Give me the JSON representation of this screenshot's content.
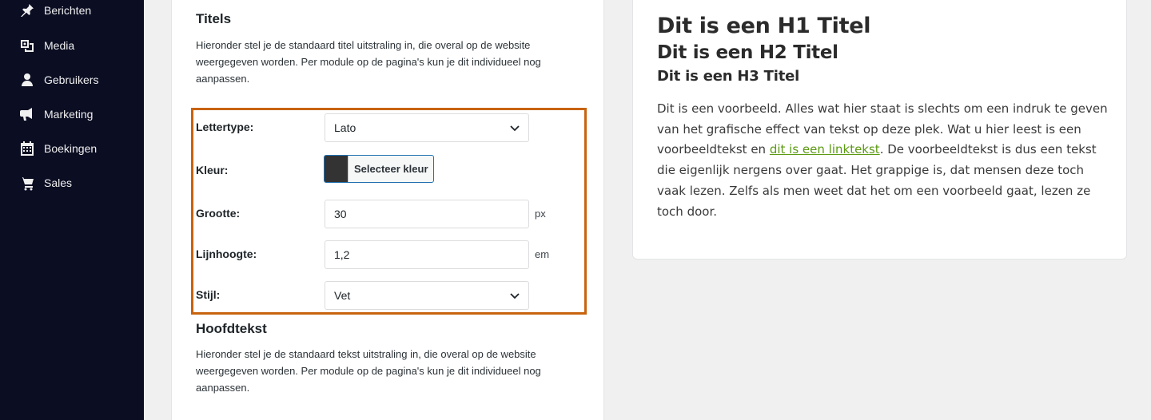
{
  "sidebar": {
    "items": [
      {
        "label": "Berichten",
        "icon": "pin-icon"
      },
      {
        "label": "Media",
        "icon": "media-icon"
      },
      {
        "label": "Gebruikers",
        "icon": "user-icon"
      },
      {
        "label": "Marketing",
        "icon": "megaphone-icon"
      },
      {
        "label": "Boekingen",
        "icon": "calendar-icon"
      },
      {
        "label": "Sales",
        "icon": "cart-icon"
      }
    ]
  },
  "titels": {
    "title": "Titels",
    "description": "Hieronder stel je de standaard titel uitstraling in, die overal op de website weergegeven worden. Per module op de pagina's kun je dit individueel nog aanpassen.",
    "fields": {
      "font_label": "Lettertype:",
      "font_value": "Lato",
      "color_label": "Kleur:",
      "color_button": "Selecteer kleur",
      "color_value": "#333333",
      "size_label": "Grootte:",
      "size_value": "30",
      "size_unit": "px",
      "lineheight_label": "Lijnhoogte:",
      "lineheight_value": "1,2",
      "lineheight_unit": "em",
      "style_label": "Stijl:",
      "style_value": "Vet"
    }
  },
  "hoofdtekst": {
    "title": "Hoofdtekst",
    "description": "Hieronder stel je de standaard tekst uitstraling in, die overal op de website weergegeven worden. Per module op de pagina's kun je dit individueel nog aanpassen."
  },
  "preview": {
    "h1": "Dit is een H1 Titel",
    "h2": "Dit is een H2 Titel",
    "h3": "Dit is een H3 Titel",
    "para_before": "Dit is een voorbeeld. Alles wat hier staat is slechts om een indruk te geven van het grafische effect van tekst op deze plek. Wat u hier leest is een voorbeeldtekst en ",
    "link": "dit is een linktekst",
    "para_after": ". De voorbeeldtekst is dus een tekst die eigenlijk nergens over gaat. Het grappige is, dat mensen deze toch vaak lezen. Zelfs als men weet dat het om een voorbeeld gaat, lezen ze toch door."
  },
  "colors": {
    "sidebar_bg": "#0b0d22",
    "highlight_border": "#c8630f",
    "link": "#5b9a12"
  }
}
